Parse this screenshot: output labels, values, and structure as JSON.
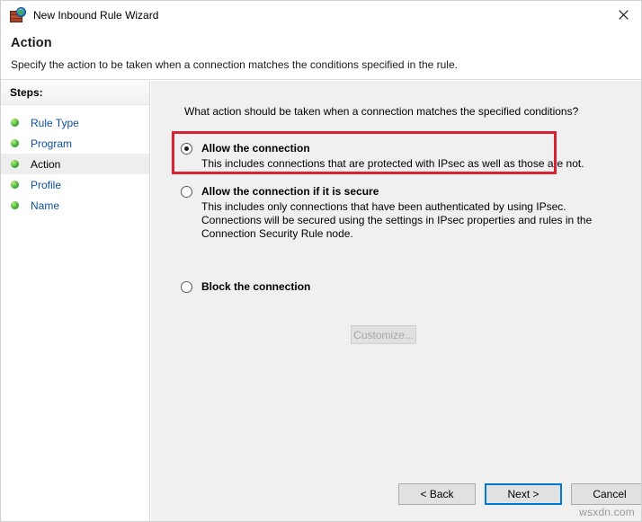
{
  "window": {
    "title": "New Inbound Rule Wizard",
    "icon": "firewall-globe-icon",
    "close_label": "✕"
  },
  "header": {
    "title": "Action",
    "subtitle": "Specify the action to be taken when a connection matches the conditions specified in the rule."
  },
  "sidebar": {
    "header": "Steps:",
    "items": [
      {
        "label": "Rule Type",
        "current": false
      },
      {
        "label": "Program",
        "current": false
      },
      {
        "label": "Action",
        "current": true
      },
      {
        "label": "Profile",
        "current": false
      },
      {
        "label": "Name",
        "current": false
      }
    ]
  },
  "main": {
    "question": "What action should be taken when a connection matches the specified conditions?",
    "options": [
      {
        "title": "Allow the connection",
        "description": "This includes connections that are protected with IPsec as well as those are not.",
        "selected": true
      },
      {
        "title": "Allow the connection if it is secure",
        "description": "This includes only connections that have been authenticated by using IPsec.  Connections will be secured using the settings in IPsec properties and rules in the Connection Security Rule node.",
        "selected": false
      },
      {
        "title": "Block the connection",
        "description": "",
        "selected": false
      }
    ],
    "customize_button": {
      "label": "Customize...",
      "enabled": false
    }
  },
  "footer": {
    "back_label": "< Back",
    "next_label": "Next >",
    "cancel_label": "Cancel"
  },
  "watermark": "wsxdn.com",
  "colors": {
    "accent": "#0078d7",
    "annotation": "#d72231",
    "link": "#0d4fa0",
    "content_bg": "#f0f0f0"
  }
}
